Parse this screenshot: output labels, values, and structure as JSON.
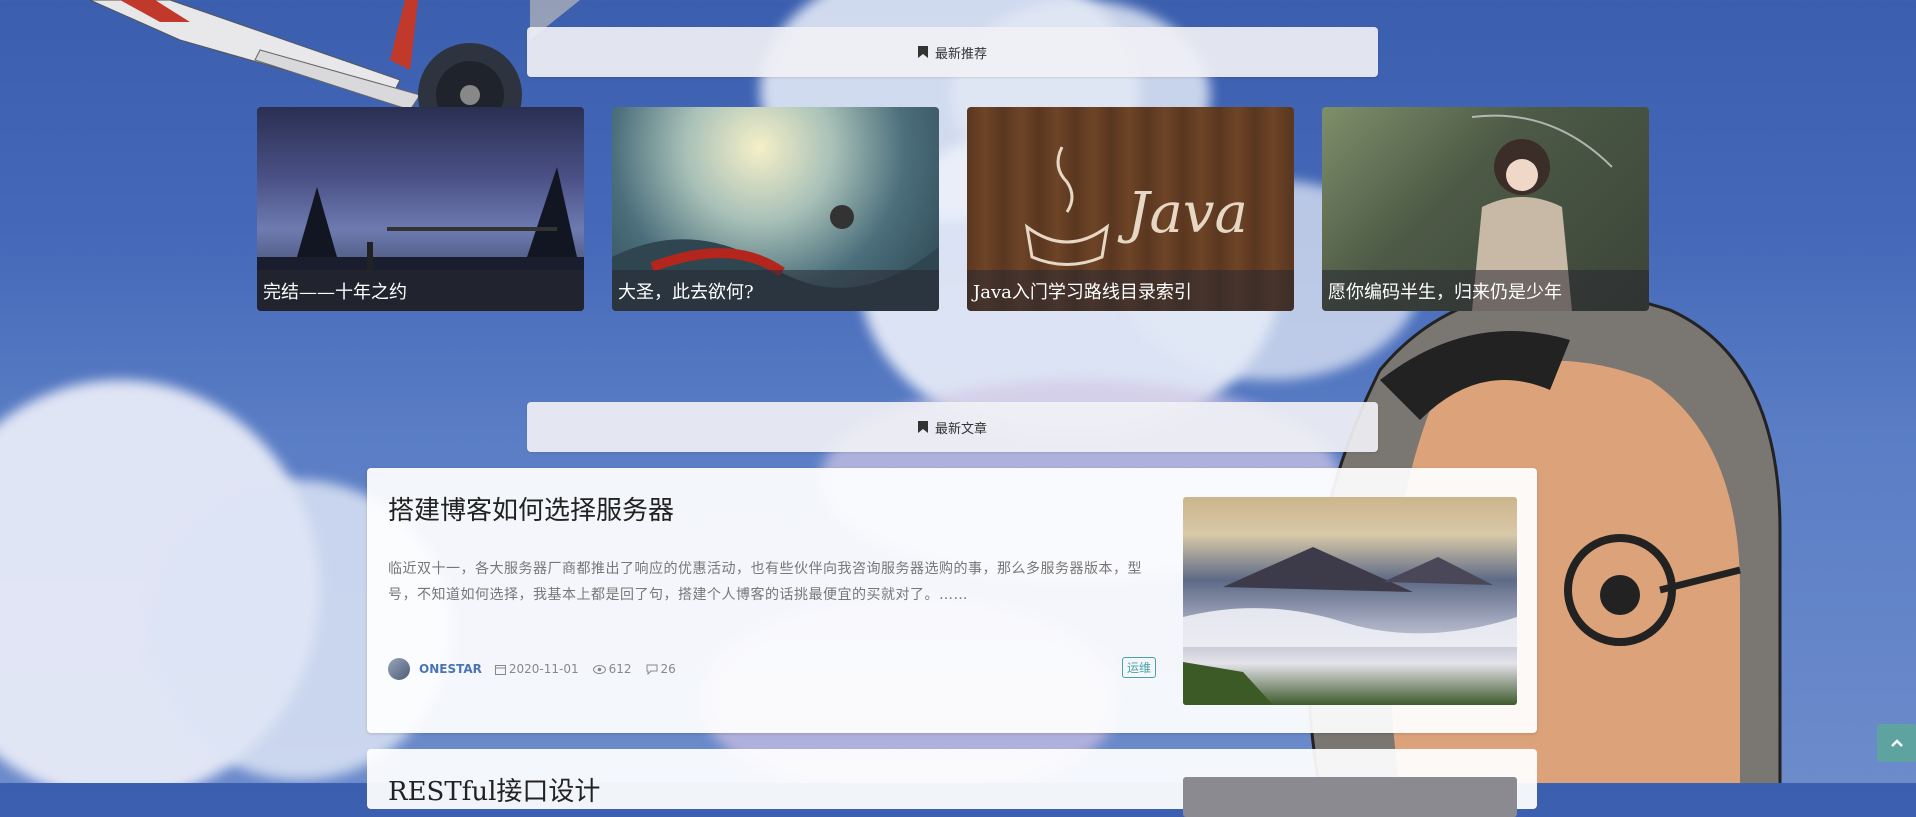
{
  "sections": {
    "recommend_label": "最新推荐",
    "latest_label": "最新文章"
  },
  "recommend_cards": [
    {
      "title": "完结——十年之约"
    },
    {
      "title": "大圣，此去欲何?"
    },
    {
      "title": "Java入门学习路线目录索引"
    },
    {
      "title": "愿你编码半生，归来仍是少年"
    }
  ],
  "java_card_text": "Java",
  "article": {
    "title": "搭建博客如何选择服务器",
    "description": "临近双十一，各大服务器厂商都推出了响应的优惠活动，也有些伙伴向我咨询服务器选购的事，那么多服务器版本，型号，不知道如何选择，我基本上都是回了句，搭建个人博客的话挑最便宜的买就对了。……",
    "author": "ONESTAR",
    "date": "2020-11-01",
    "views": "612",
    "comments": "26",
    "tag": "运维"
  },
  "article2": {
    "title": "RESTful接口设计"
  },
  "colors": {
    "accent": "#4aa3a0",
    "author": "#4a74b5"
  }
}
